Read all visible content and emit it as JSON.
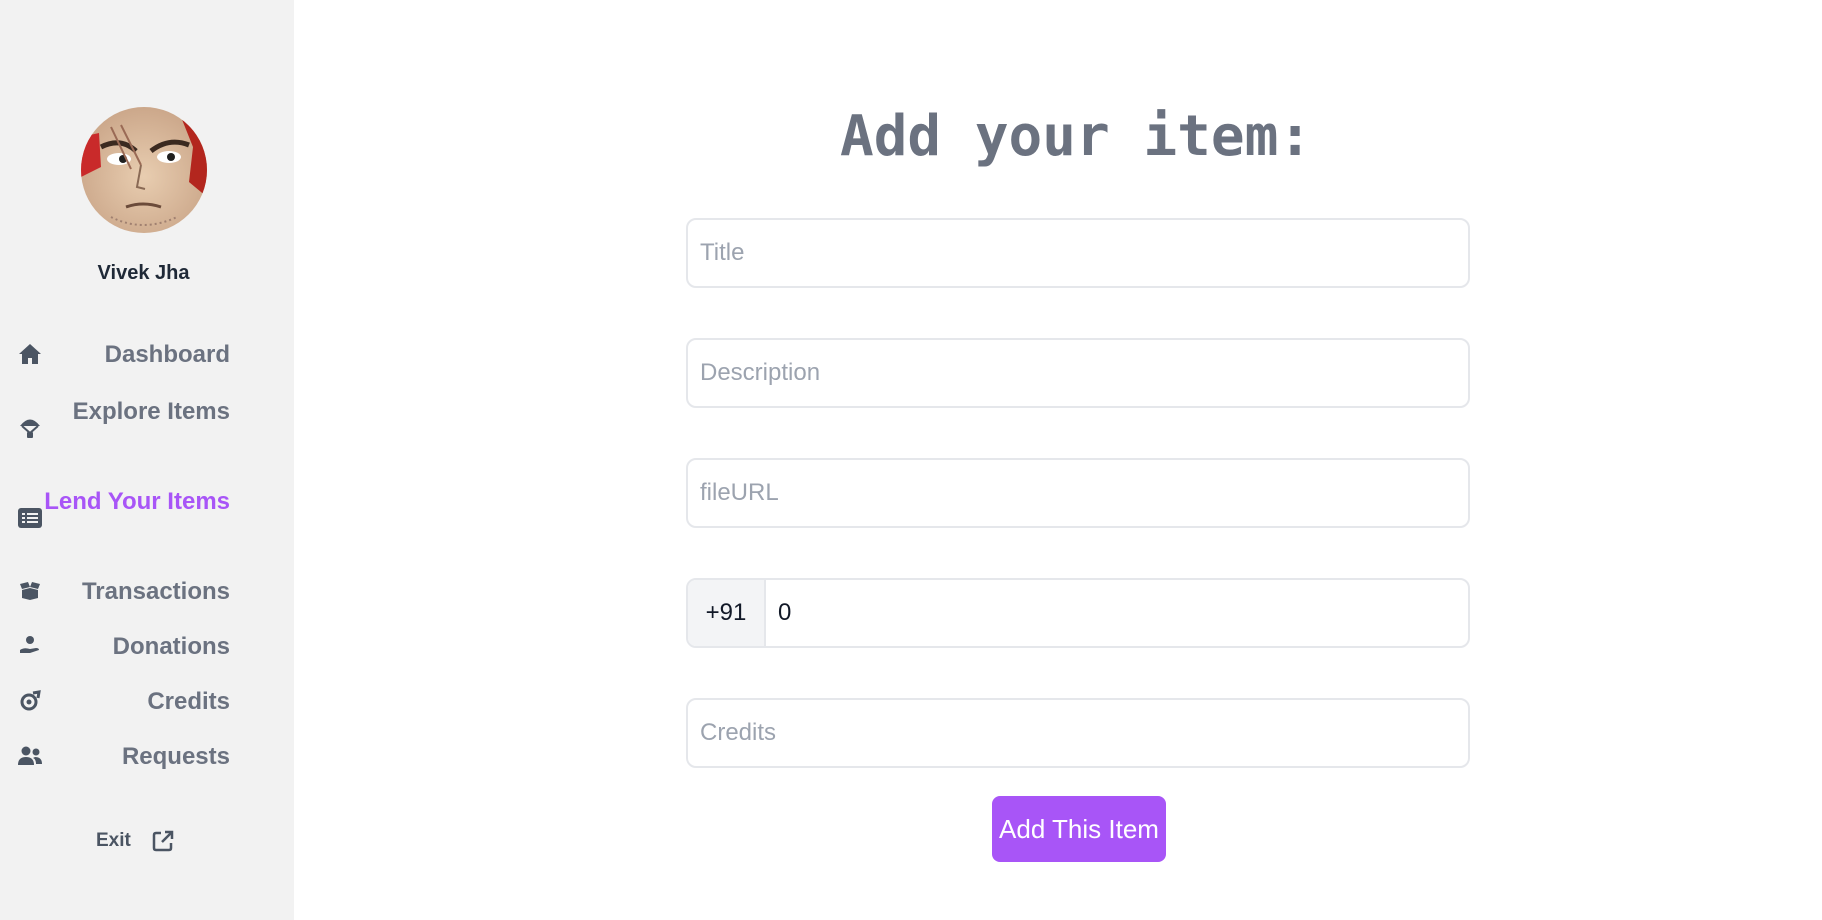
{
  "sidebar": {
    "user_name": "Vivek Jha",
    "nav": [
      {
        "label": "Dashboard",
        "icon": "home-icon"
      },
      {
        "label": "Explore Items",
        "icon": "parachute-icon"
      },
      {
        "label": "Lend Your Items",
        "icon": "list-icon",
        "active": true
      },
      {
        "label": "Transactions",
        "icon": "box-open-icon"
      },
      {
        "label": "Donations",
        "icon": "hand-holding-icon"
      },
      {
        "label": "Credits",
        "icon": "coin-icon"
      },
      {
        "label": "Requests",
        "icon": "users-icon"
      }
    ],
    "exit_label": "Exit",
    "exit_icon": "external-link-icon"
  },
  "form": {
    "title": "Add your item:",
    "title_placeholder": "Title",
    "description_placeholder": "Description",
    "file_url_placeholder": "fileURL",
    "phone_prefix": "+91",
    "phone_value": "0",
    "credits_placeholder": "Credits",
    "submit_label": "Add This Item"
  },
  "colors": {
    "accent": "#a855f7",
    "sidebar_bg": "#f2f2f2",
    "nav_text": "#6b7280"
  }
}
